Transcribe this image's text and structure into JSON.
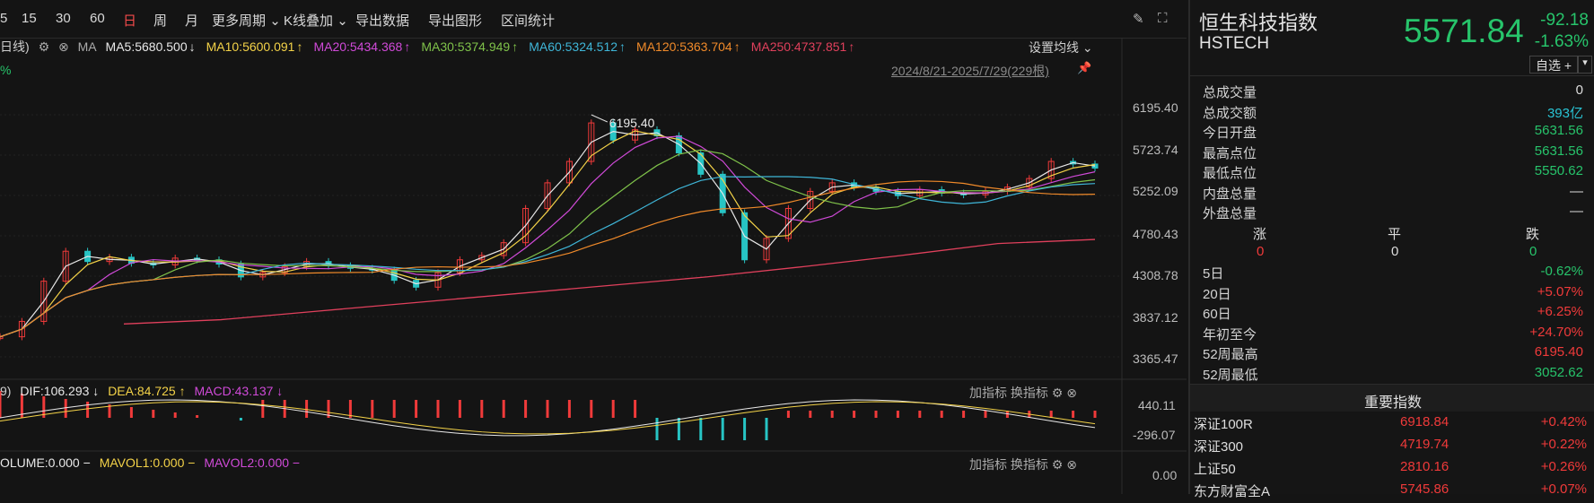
{
  "toolbar": {
    "periods": [
      "5",
      "15",
      "30",
      "60",
      "日",
      "周",
      "月"
    ],
    "active": "日",
    "more_periods": "更多周期",
    "k_overlay": "K线叠加",
    "export_data": "导出数据",
    "export_chart": "导出图形",
    "range_stats": "区间统计"
  },
  "ma_bar": {
    "prefix": "日线)",
    "ma_label": "MA",
    "items": [
      {
        "text": "MA5:5680.500",
        "arrow": "↓",
        "color": "#e8e8e8",
        "arrow_color": "#e8e8e8"
      },
      {
        "text": "MA10:5600.091",
        "arrow": "↑",
        "color": "#f3d248",
        "arrow_color": "#f3d248"
      },
      {
        "text": "MA20:5434.368",
        "arrow": "↑",
        "color": "#d04ad8",
        "arrow_color": "#d04ad8"
      },
      {
        "text": "MA30:5374.949",
        "arrow": "↑",
        "color": "#7fc24a",
        "arrow_color": "#7fc24a"
      },
      {
        "text": "MA60:5324.512",
        "arrow": "↑",
        "color": "#3fb6d8",
        "arrow_color": "#3fb6d8"
      },
      {
        "text": "MA120:5363.704",
        "arrow": "↑",
        "color": "#f08a2a",
        "arrow_color": "#f08a2a"
      },
      {
        "text": "MA250:4737.851",
        "arrow": "↑",
        "color": "#e0405c",
        "arrow_color": "#e0405c"
      }
    ],
    "settings": "设置均线"
  },
  "pct_label": "%",
  "date_range": "2024/8/21-2025/7/29(229根)",
  "peak_label": "6195.40",
  "price_axis": [
    "6195.40",
    "5723.74",
    "5252.09",
    "4780.43",
    "4308.78",
    "3837.12",
    "3365.47"
  ],
  "macd_bar": {
    "prefix": "9)",
    "dif": "DIF:106.293",
    "dif_arrow": "↓",
    "dea": "DEA:84.725",
    "dea_arrow": "↑",
    "macd": "MACD:43.137",
    "macd_arrow": "↓",
    "add_indicator": "加指标",
    "switch_indicator": "换指标",
    "axis": [
      "440.11",
      "-296.07"
    ]
  },
  "vol_bar": {
    "volume": "OLUME:0.000",
    "mavol1": "MAVOL1:0.000",
    "mavol2": "MAVOL2:0.000",
    "add_indicator": "加指标",
    "switch_indicator": "换指标",
    "axis": "0.00"
  },
  "quote": {
    "name": "恒生科技指数",
    "code": "HSTECH",
    "price": "5571.84",
    "change": "-92.18",
    "change_pct": "-1.63%",
    "watchlist": "自选 +"
  },
  "stats": [
    {
      "k": "总成交量",
      "v": "0",
      "cls": "white"
    },
    {
      "k": "总成交额",
      "v": "393亿",
      "cls": "blue"
    },
    {
      "k": "今日开盘",
      "v": "5631.56",
      "cls": "green"
    },
    {
      "k": "最高点位",
      "v": "5631.56",
      "cls": "green"
    },
    {
      "k": "最低点位",
      "v": "5550.62",
      "cls": "green"
    },
    {
      "k": "内盘总量",
      "v": "—",
      "cls": "white"
    },
    {
      "k": "外盘总量",
      "v": "—",
      "cls": "white"
    }
  ],
  "breadth": {
    "up_label": "涨",
    "flat_label": "平",
    "down_label": "跌",
    "up": "0",
    "flat": "0",
    "down": "0"
  },
  "perf": [
    {
      "k": "5日",
      "v": "-0.62%",
      "cls": "green"
    },
    {
      "k": "20日",
      "v": "+5.07%",
      "cls": "red"
    },
    {
      "k": "60日",
      "v": "+6.25%",
      "cls": "red"
    },
    {
      "k": "年初至今",
      "v": "+24.70%",
      "cls": "red"
    },
    {
      "k": "52周最高",
      "v": "6195.40",
      "cls": "red"
    },
    {
      "k": "52周最低",
      "v": "3052.62",
      "cls": "green"
    }
  ],
  "indices_title": "重要指数",
  "indices": [
    {
      "n": "深证100R",
      "p": "6918.84",
      "c": "+0.42%"
    },
    {
      "n": "深证300",
      "p": "4719.74",
      "c": "+0.22%"
    },
    {
      "n": "上证50",
      "p": "2810.16",
      "c": "+0.26%"
    },
    {
      "n": "东方财富全A",
      "p": "5745.86",
      "c": "+0.07%"
    }
  ],
  "colors": {
    "up": "#f03a3a",
    "down": "#27c4c4",
    "bg": "#141414"
  },
  "chart_data": {
    "type": "line",
    "y_ticks": [
      6195.4,
      5723.74,
      5252.09,
      4780.43,
      4308.78,
      3837.12,
      3365.47
    ],
    "ylim": [
      3365.47,
      6195.4
    ],
    "close": [
      3600,
      3780,
      4250,
      4600,
      4480,
      4530,
      4460,
      4440,
      4520,
      4500,
      4450,
      4300,
      4350,
      4420,
      4480,
      4430,
      4400,
      4380,
      4260,
      4180,
      4350,
      4500,
      4550,
      4700,
      5100,
      5400,
      5650,
      6100,
      5900,
      6020,
      5950,
      5750,
      5500,
      5050,
      4500,
      4750,
      5100,
      5300,
      5400,
      5350,
      5300,
      5250,
      5320,
      5280,
      5260,
      5300,
      5350,
      5450,
      5650,
      5620,
      5572
    ],
    "ma250": [
      3750,
      3800,
      3900,
      4000,
      4100,
      4200,
      4300,
      4420,
      4550,
      4690,
      4737.851
    ],
    "peak": 6195.4,
    "macd_axis": [
      440.11,
      -296.07
    ]
  }
}
